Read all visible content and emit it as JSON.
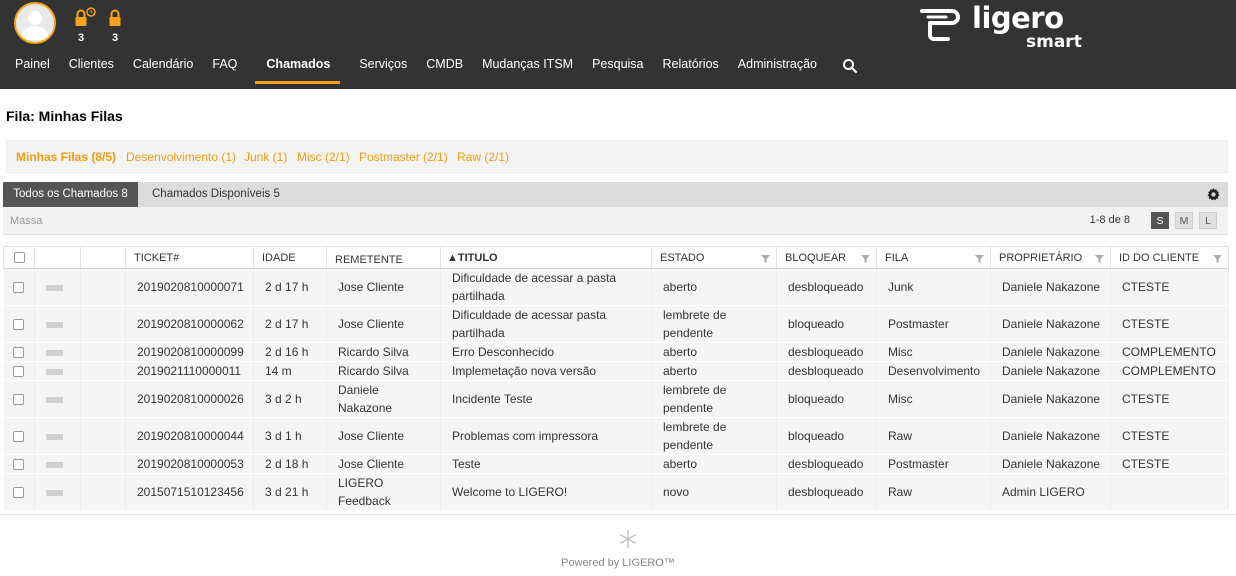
{
  "header": {
    "locks": [
      {
        "icon": "lock-watch-icon",
        "count": "3"
      },
      {
        "icon": "lock-icon",
        "count": "3"
      }
    ],
    "logo": {
      "word": "ligero",
      "sub": "smart"
    },
    "nav": [
      {
        "label": "Painel",
        "active": false
      },
      {
        "label": "Clientes",
        "active": false
      },
      {
        "label": "Calendário",
        "active": false
      },
      {
        "label": "FAQ",
        "active": false
      },
      {
        "label": "Chamados",
        "active": true
      },
      {
        "label": "Serviços",
        "active": false
      },
      {
        "label": "CMDB",
        "active": false
      },
      {
        "label": "Mudanças ITSM",
        "active": false
      },
      {
        "label": "Pesquisa",
        "active": false
      },
      {
        "label": "Relatórios",
        "active": false
      },
      {
        "label": "Administração",
        "active": false
      }
    ],
    "accent": "#f7a21b",
    "bar_color": "#333333"
  },
  "page_title": "Fila: Minhas Filas",
  "queues": [
    {
      "label": "Minhas Filas (8/5)",
      "selected": true
    },
    {
      "label": "Desenvolvimento (1)",
      "selected": false
    },
    {
      "label": "Junk (1)",
      "selected": false
    },
    {
      "label": "Misc (2/1)",
      "selected": false
    },
    {
      "label": "Postmaster (2/1)",
      "selected": false
    },
    {
      "label": "Raw (2/1)",
      "selected": false
    }
  ],
  "tabs": {
    "all": "Todos os Chamados 8",
    "available": "Chamados Disponíveis 5"
  },
  "bulk": {
    "label": "Massa",
    "count": "1-8 de 8",
    "sizes": [
      "S",
      "M",
      "L"
    ]
  },
  "table": {
    "columns": [
      "TICKET#",
      "IDADE",
      "REMETENTE",
      "▲TITULO",
      "ESTADO",
      "BLOQUEAR",
      "FILA",
      "PROPRIETÁRIO",
      "ID DO CLIENTE"
    ],
    "rows": [
      {
        "ticket": "2019020810000071",
        "age": "2 d 17 h",
        "sender": "Jose Cliente",
        "title": "Dificuldade de acessar a pasta partilhada",
        "state": "aberto",
        "lock": "desbloqueado",
        "queue": "Junk",
        "owner": "Daniele Nakazone",
        "customer": "CTESTE"
      },
      {
        "ticket": "2019020810000062",
        "age": "2 d 17 h",
        "sender": "Jose Cliente",
        "title": "Dificuldade de acessar pasta partilhada",
        "state": "lembrete de pendente",
        "lock": "bloqueado",
        "queue": "Postmaster",
        "owner": "Daniele Nakazone",
        "customer": "CTESTE"
      },
      {
        "ticket": "2019020810000099",
        "age": "2 d 16 h",
        "sender": "Ricardo Silva",
        "title": "Erro Desconhecido",
        "state": "aberto",
        "lock": "desbloqueado",
        "queue": "Misc",
        "owner": "Daniele Nakazone",
        "customer": "COMPLEMENTO"
      },
      {
        "ticket": "2019021110000011",
        "age": "14 m",
        "sender": "Ricardo Silva",
        "title": "Implemetação nova versão",
        "state": "aberto",
        "lock": "desbloqueado",
        "queue": "Desenvolvimento",
        "owner": "Daniele Nakazone",
        "customer": "COMPLEMENTO"
      },
      {
        "ticket": "2019020810000026",
        "age": "3 d 2 h",
        "sender": "Daniele Nakazone",
        "title": "Incidente Teste",
        "state": "lembrete de pendente",
        "lock": "bloqueado",
        "queue": "Misc",
        "owner": "Daniele Nakazone",
        "customer": "CTESTE"
      },
      {
        "ticket": "2019020810000044",
        "age": "3 d 1 h",
        "sender": "Jose Cliente",
        "title": "Problemas com impressora",
        "state": "lembrete de pendente",
        "lock": "bloqueado",
        "queue": "Raw",
        "owner": "Daniele Nakazone",
        "customer": "CTESTE"
      },
      {
        "ticket": "2019020810000053",
        "age": "2 d 18 h",
        "sender": "Jose Cliente",
        "title": "Teste",
        "state": "aberto",
        "lock": "desbloqueado",
        "queue": "Postmaster",
        "owner": "Daniele Nakazone",
        "customer": "CTESTE"
      },
      {
        "ticket": "2015071510123456",
        "age": "3 d 21 h",
        "sender": "LIGERO Feedback",
        "title": "Welcome to LIGERO!",
        "state": "novo",
        "lock": "desbloqueado",
        "queue": "Raw",
        "owner": "Admin LIGERO",
        "customer": ""
      }
    ]
  },
  "footer": "Powered by LIGERO™"
}
